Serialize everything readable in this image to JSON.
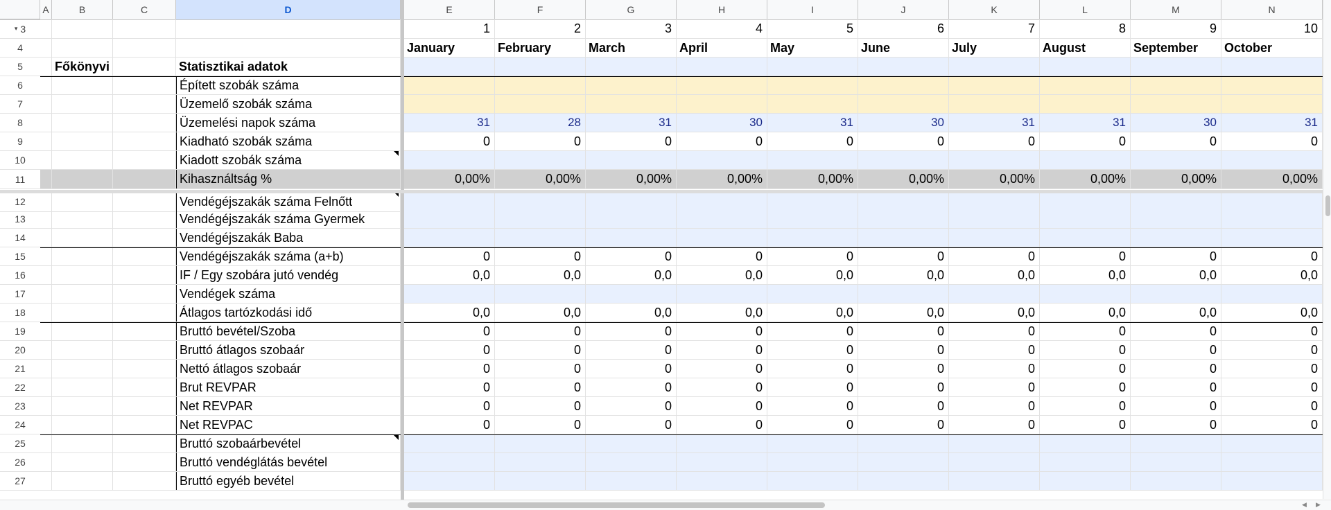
{
  "columns": [
    {
      "key": "A",
      "label": "A"
    },
    {
      "key": "B",
      "label": "B"
    },
    {
      "key": "C",
      "label": "C"
    },
    {
      "key": "D",
      "label": "D"
    },
    {
      "key": "E",
      "label": "E"
    },
    {
      "key": "F",
      "label": "F"
    },
    {
      "key": "G",
      "label": "G"
    },
    {
      "key": "H",
      "label": "H"
    },
    {
      "key": "I",
      "label": "I"
    },
    {
      "key": "J",
      "label": "J"
    },
    {
      "key": "K",
      "label": "K"
    },
    {
      "key": "L",
      "label": "L"
    },
    {
      "key": "M",
      "label": "M"
    },
    {
      "key": "N",
      "label": "N"
    }
  ],
  "selected_column": "D",
  "month_numbers": [
    "1",
    "2",
    "3",
    "4",
    "5",
    "6",
    "7",
    "8",
    "9",
    "10"
  ],
  "months": [
    "January",
    "February",
    "March",
    "April",
    "May",
    "June",
    "July",
    "August",
    "September",
    "October"
  ],
  "header_row5": {
    "b": "Főkönyvi szám",
    "d": "Statisztikai adatok"
  },
  "rows": [
    {
      "num": "3",
      "label": "",
      "kind": "monthnum"
    },
    {
      "num": "4",
      "label": "",
      "kind": "monthname"
    },
    {
      "num": "5",
      "label": "",
      "kind": "header"
    },
    {
      "num": "6",
      "label": "Épített szobák száma",
      "kind": "yellow"
    },
    {
      "num": "7",
      "label": "Üzemelő szobák száma",
      "kind": "yellow"
    },
    {
      "num": "8",
      "label": "Üzemelési napok száma",
      "kind": "days",
      "values": [
        "31",
        "28",
        "31",
        "30",
        "31",
        "30",
        "31",
        "31",
        "30",
        "31"
      ]
    },
    {
      "num": "9",
      "label": "Kiadható szobák száma",
      "kind": "values",
      "values": [
        "0",
        "0",
        "0",
        "0",
        "0",
        "0",
        "0",
        "0",
        "0",
        "0"
      ]
    },
    {
      "num": "10",
      "label": "Kiadott szobák száma",
      "kind": "blue"
    },
    {
      "num": "11",
      "label": "Kihasználtság %",
      "kind": "gray",
      "values": [
        "0,00%",
        "0,00%",
        "0,00%",
        "0,00%",
        "0,00%",
        "0,00%",
        "0,00%",
        "0,00%",
        "0,00%",
        "0,00%"
      ]
    },
    {
      "num": "12",
      "label": "Vendégéjszakák száma Felnőtt",
      "kind": "blue"
    },
    {
      "num": "13",
      "label": "Vendégéjszakák száma Gyermek",
      "kind": "blue"
    },
    {
      "num": "14",
      "label": "Vendégéjszakák Baba",
      "kind": "blue"
    },
    {
      "num": "15",
      "label": "Vendégéjszakák száma (a+b)",
      "kind": "values",
      "values": [
        "0",
        "0",
        "0",
        "0",
        "0",
        "0",
        "0",
        "0",
        "0",
        "0"
      ]
    },
    {
      "num": "16",
      "label": "IF / Egy szobára jutó vendég",
      "kind": "values",
      "values": [
        "0,0",
        "0,0",
        "0,0",
        "0,0",
        "0,0",
        "0,0",
        "0,0",
        "0,0",
        "0,0",
        "0,0"
      ]
    },
    {
      "num": "17",
      "label": "Vendégek száma",
      "kind": "blue"
    },
    {
      "num": "18",
      "label": "Átlagos tartózkodási idő",
      "kind": "values",
      "values": [
        "0,0",
        "0,0",
        "0,0",
        "0,0",
        "0,0",
        "0,0",
        "0,0",
        "0,0",
        "0,0",
        "0,0"
      ]
    },
    {
      "num": "19",
      "label": "Bruttó bevétel/Szoba",
      "kind": "values",
      "values": [
        "0",
        "0",
        "0",
        "0",
        "0",
        "0",
        "0",
        "0",
        "0",
        "0"
      ]
    },
    {
      "num": "20",
      "label": "Bruttó átlagos szobaár",
      "kind": "values",
      "values": [
        "0",
        "0",
        "0",
        "0",
        "0",
        "0",
        "0",
        "0",
        "0",
        "0"
      ]
    },
    {
      "num": "21",
      "label": "Nettó átlagos szobaár",
      "kind": "values",
      "values": [
        "0",
        "0",
        "0",
        "0",
        "0",
        "0",
        "0",
        "0",
        "0",
        "0"
      ]
    },
    {
      "num": "22",
      "label": "Brut REVPAR",
      "kind": "values",
      "values": [
        "0",
        "0",
        "0",
        "0",
        "0",
        "0",
        "0",
        "0",
        "0",
        "0"
      ]
    },
    {
      "num": "23",
      "label": "Net REVPAR",
      "kind": "values",
      "values": [
        "0",
        "0",
        "0",
        "0",
        "0",
        "0",
        "0",
        "0",
        "0",
        "0"
      ]
    },
    {
      "num": "24",
      "label": "Net REVPAC",
      "kind": "values",
      "values": [
        "0",
        "0",
        "0",
        "0",
        "0",
        "0",
        "0",
        "0",
        "0",
        "0"
      ]
    },
    {
      "num": "25",
      "label": "Bruttó szobaárbevétel",
      "kind": "blue"
    },
    {
      "num": "26",
      "label": "Bruttó vendéglátás bevétel",
      "kind": "blue"
    },
    {
      "num": "27",
      "label": "Bruttó egyéb bevétel",
      "kind": "blue"
    }
  ],
  "colors": {
    "blue_fill": "#e8f0fe",
    "yellow_fill": "#fdf2cc",
    "gray_fill": "#d0d0d0",
    "days_text": "#1a2a8a",
    "selected_header": "#d3e3fd"
  }
}
